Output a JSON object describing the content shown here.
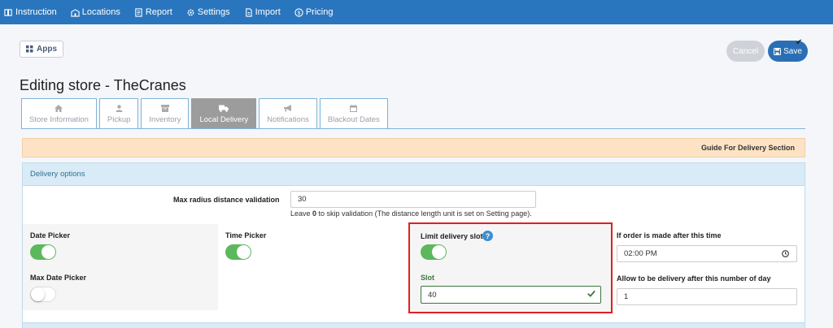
{
  "nav": [
    {
      "label": "Instruction",
      "icon": "book-icon"
    },
    {
      "label": "Locations",
      "icon": "building-icon"
    },
    {
      "label": "Report",
      "icon": "report-icon"
    },
    {
      "label": "Settings",
      "icon": "gear-icon"
    },
    {
      "label": "Import",
      "icon": "file-import-icon"
    },
    {
      "label": "Pricing",
      "icon": "dollar-icon"
    }
  ],
  "apps_label": "Apps",
  "cancel_label": "Cancel",
  "save_label": "Save",
  "page_title": "Editing store - TheCranes",
  "tabs": [
    {
      "label": "Store Information",
      "icon": "home-icon",
      "active": false
    },
    {
      "label": "Pickup",
      "icon": "user-icon",
      "active": false
    },
    {
      "label": "Inventory",
      "icon": "inventory-icon",
      "active": false
    },
    {
      "label": "Local Delivery",
      "icon": "truck-icon",
      "active": true
    },
    {
      "label": "Notifications",
      "icon": "bullhorn-icon",
      "active": false
    },
    {
      "label": "Blackout Dates",
      "icon": "calendar-icon",
      "active": false
    }
  ],
  "guide_label": "Guide For Delivery Section",
  "panel_title": "Delivery options",
  "max_radius": {
    "label": "Max radius distance validation",
    "value": "30",
    "help_prefix": "Leave ",
    "help_bold": "0",
    "help_suffix": " to skip validation (The distance length unit is set on Setting page)."
  },
  "date_picker": {
    "label": "Date Picker",
    "enabled": true
  },
  "max_date_picker": {
    "label": "Max Date Picker",
    "enabled": false
  },
  "time_picker": {
    "label": "Time Picker",
    "enabled": true
  },
  "limit_slot": {
    "label": "Limit delivery slot",
    "help": "?",
    "enabled": true
  },
  "slot": {
    "label": "Slot",
    "value": "40"
  },
  "cutoff": {
    "label": "If order is made after this time",
    "value": "02:00  PM"
  },
  "allow_days": {
    "label": "Allow to be delivery after this number of day",
    "value": "1"
  },
  "colors": {
    "nav": "#2a76be",
    "toggle_on": "#5cb85c",
    "highlight": "#e02020"
  }
}
